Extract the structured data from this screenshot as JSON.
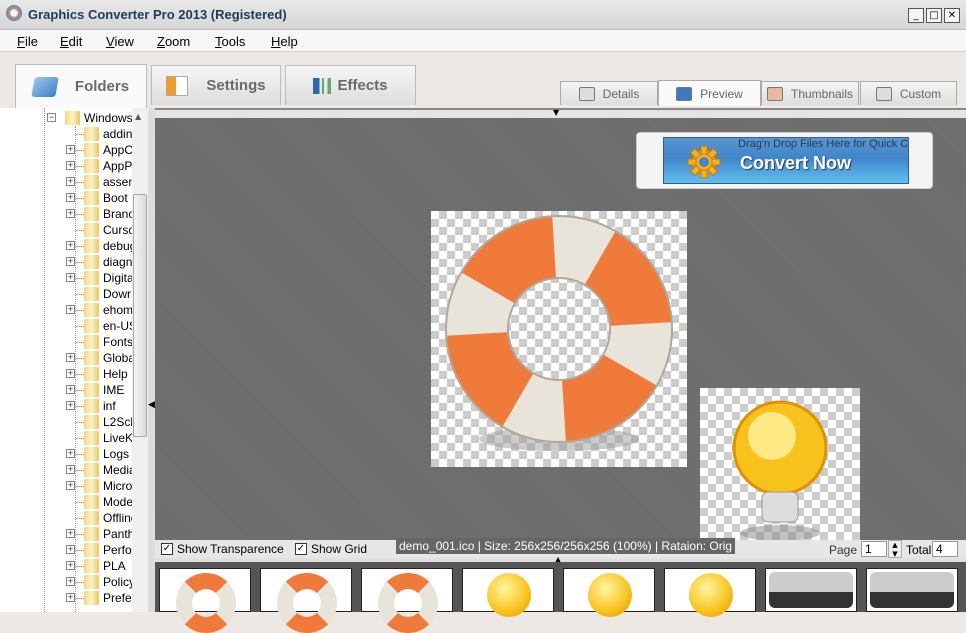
{
  "window": {
    "title": "Graphics Converter Pro 2013  (Registered)",
    "minimize": "_",
    "maximize": "□",
    "close": "✕"
  },
  "menu": [
    {
      "label": "File",
      "key": "F",
      "rest": "ile"
    },
    {
      "label": "Edit",
      "key": "E",
      "rest": "dit"
    },
    {
      "label": "View",
      "key": "V",
      "rest": "iew"
    },
    {
      "label": "Zoom",
      "key": "Z",
      "rest": "oom"
    },
    {
      "label": "Tools",
      "key": "T",
      "rest": "ools"
    },
    {
      "label": "Help",
      "key": "H",
      "rest": "elp"
    }
  ],
  "main_tabs": [
    {
      "label": "Folders",
      "icon": "folder-icon",
      "active": true
    },
    {
      "label": "Settings",
      "icon": "settings-checklist-icon"
    },
    {
      "label": "Effects",
      "icon": "effects-sliders-icon"
    }
  ],
  "view_tabs": [
    {
      "label": "Details",
      "icon": "details-icon"
    },
    {
      "label": "Preview",
      "icon": "preview-icon",
      "active": true
    },
    {
      "label": "Thumbnails",
      "icon": "thumbnails-icon"
    },
    {
      "label": "Custom",
      "icon": "custom-icon"
    }
  ],
  "tree": {
    "root": "Windows",
    "items": [
      {
        "name": "addin",
        "exp": false
      },
      {
        "name": "AppC",
        "exp": true
      },
      {
        "name": "AppP",
        "exp": true
      },
      {
        "name": "assen",
        "exp": true
      },
      {
        "name": "Boot",
        "exp": true
      },
      {
        "name": "Branc",
        "exp": true
      },
      {
        "name": "Curso",
        "exp": false
      },
      {
        "name": "debug",
        "exp": true
      },
      {
        "name": "diagn",
        "exp": true
      },
      {
        "name": "Digita",
        "exp": true
      },
      {
        "name": "Dowr",
        "exp": false
      },
      {
        "name": "ehom",
        "exp": true
      },
      {
        "name": "en-US",
        "exp": false
      },
      {
        "name": "Fonts",
        "exp": false
      },
      {
        "name": "Globa",
        "exp": true
      },
      {
        "name": "Help",
        "exp": true
      },
      {
        "name": "IME",
        "exp": true
      },
      {
        "name": "inf",
        "exp": true
      },
      {
        "name": "L2Scl",
        "exp": false
      },
      {
        "name": "LiveK",
        "exp": false
      },
      {
        "name": "Logs",
        "exp": true
      },
      {
        "name": "Media",
        "exp": true
      },
      {
        "name": "Micro",
        "exp": true
      },
      {
        "name": "Mode",
        "exp": false
      },
      {
        "name": "Offline",
        "exp": false
      },
      {
        "name": "Panth",
        "exp": true
      },
      {
        "name": "Perfor",
        "exp": true
      },
      {
        "name": "PLA",
        "exp": true
      },
      {
        "name": "Policy",
        "exp": true
      },
      {
        "name": "Prefel",
        "exp": true
      }
    ]
  },
  "convert": {
    "hint": "Drag'n Drop Files Here for Quick Conversion",
    "label": "Convert Now"
  },
  "bottom": {
    "show_transparence": "Show Transparence",
    "show_grid": "Show Grid",
    "transparence_checked": true,
    "grid_checked": true,
    "info": "demo_001.ico  |  Size: 256x256/256x256 (100%)  |  Rataion: Orig",
    "page_label": "Page",
    "page": "1",
    "total_label": "Total",
    "total": "4"
  },
  "colors": {
    "preview_bg": "#6e6e6e",
    "convert_blue": "#3f86cc",
    "lifebuoy_orange": "#f07a3a"
  }
}
